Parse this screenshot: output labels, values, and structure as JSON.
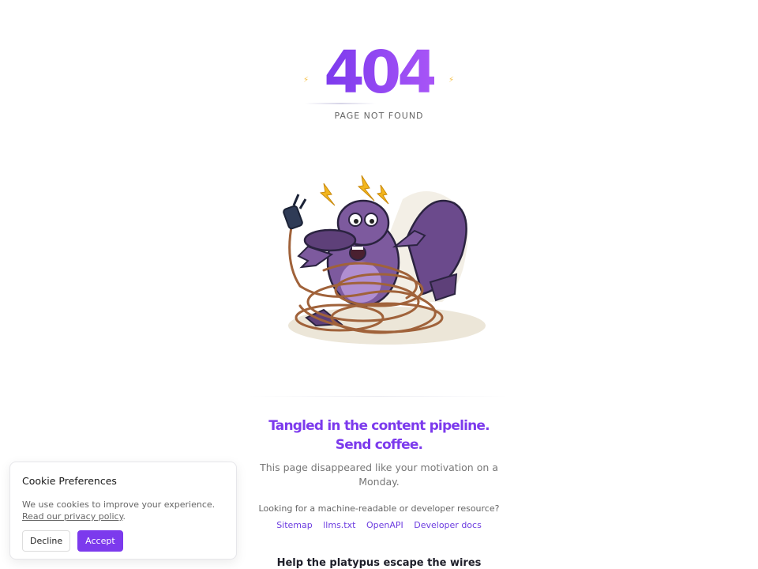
{
  "hero": {
    "code": "404",
    "subtitle": "PAGE NOT FOUND"
  },
  "illustration": {
    "name": "tangled-platypus-illustration",
    "colors": {
      "body": "#7d5a9e",
      "belly": "#b08ed1",
      "wire": "#a0623a",
      "plug": "#2f3b56",
      "spark": "#f2b51d"
    }
  },
  "message": {
    "headline": "Tangled in the content pipeline. Send coffee.",
    "tagline": "This page disappeared like your motivation on a Monday."
  },
  "developer": {
    "question": "Looking for a machine-readable or developer resource?",
    "links": [
      "Sitemap",
      "llms.txt",
      "OpenAPI",
      "Developer docs"
    ]
  },
  "game": {
    "title": "Help the platypus escape the wires"
  },
  "cookie": {
    "title": "Cookie Preferences",
    "text": "We use cookies to improve your experience.",
    "link": "Read our privacy policy",
    "link_suffix": ".",
    "decline": "Decline",
    "accept": "Accept"
  },
  "colors": {
    "accent": "#7c3aed",
    "accent_light": "#a855f7",
    "spark": "#f5c046"
  }
}
